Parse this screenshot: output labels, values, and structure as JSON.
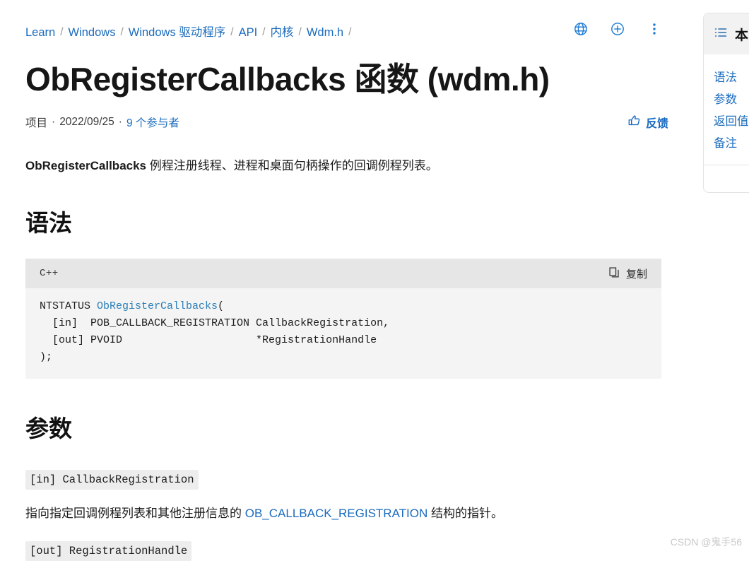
{
  "breadcrumb": {
    "separator": "/",
    "items": [
      {
        "label": "Learn"
      },
      {
        "label": "Windows"
      },
      {
        "label": "Windows 驱动程序"
      },
      {
        "label": "API"
      },
      {
        "label": "内核"
      },
      {
        "label": "Wdm.h"
      }
    ]
  },
  "header_actions": [
    {
      "name": "globe-icon",
      "label": "语言"
    },
    {
      "name": "plus-circle-icon",
      "label": "添加"
    },
    {
      "name": "more-vertical-icon",
      "label": "更多"
    }
  ],
  "page": {
    "title_main": "ObRegisterCallbacks ",
    "title_cjk": "函数",
    "title_tail": " (wdm.h)"
  },
  "meta": {
    "type": "项目",
    "dot": "·",
    "date": "2022/09/25",
    "contributors": "9 个参与者"
  },
  "feedback": {
    "label": "反馈",
    "icon": "thumbs-up-icon"
  },
  "lead": {
    "bold": "ObRegisterCallbacks",
    "rest": " 例程注册线程、进程和桌面句柄操作的回调例程列表。"
  },
  "sections": {
    "syntax_heading": "语法",
    "params_heading": "参数"
  },
  "code": {
    "language": "C++",
    "copy_label": "复制",
    "line1_type": "NTSTATUS ",
    "line1_fn": "ObRegisterCallbacks",
    "line1_paren": "(",
    "line2": "  [in]  POB_CALLBACK_REGISTRATION CallbackRegistration,",
    "line3": "  [out] PVOID                     *RegistrationHandle",
    "line4": ");"
  },
  "parameters": [
    {
      "signature": "[in] CallbackRegistration",
      "desc_before": "指向指定回调例程列表和其他注册信息的 ",
      "desc_link": "OB_CALLBACK_REGISTRATION",
      "desc_after": " 结构的指针。"
    },
    {
      "signature": "[out] RegistrationHandle"
    }
  ],
  "toc": {
    "icon": "list-icon",
    "title": "本",
    "items": [
      {
        "label": "语法"
      },
      {
        "label": "参数"
      },
      {
        "label": "返回值"
      },
      {
        "label": "备注"
      }
    ]
  },
  "watermark": {
    "text": "CSDN @鬼手56"
  },
  "colors": {
    "link": "#1a6bbd",
    "accent": "#1668c1",
    "code_bg": "#f4f4f4",
    "code_head_bg": "#e6e6e6",
    "chip_bg": "#ededed",
    "toc_head_bg": "#f2f2f2",
    "watermark": "#c9c9c9"
  }
}
